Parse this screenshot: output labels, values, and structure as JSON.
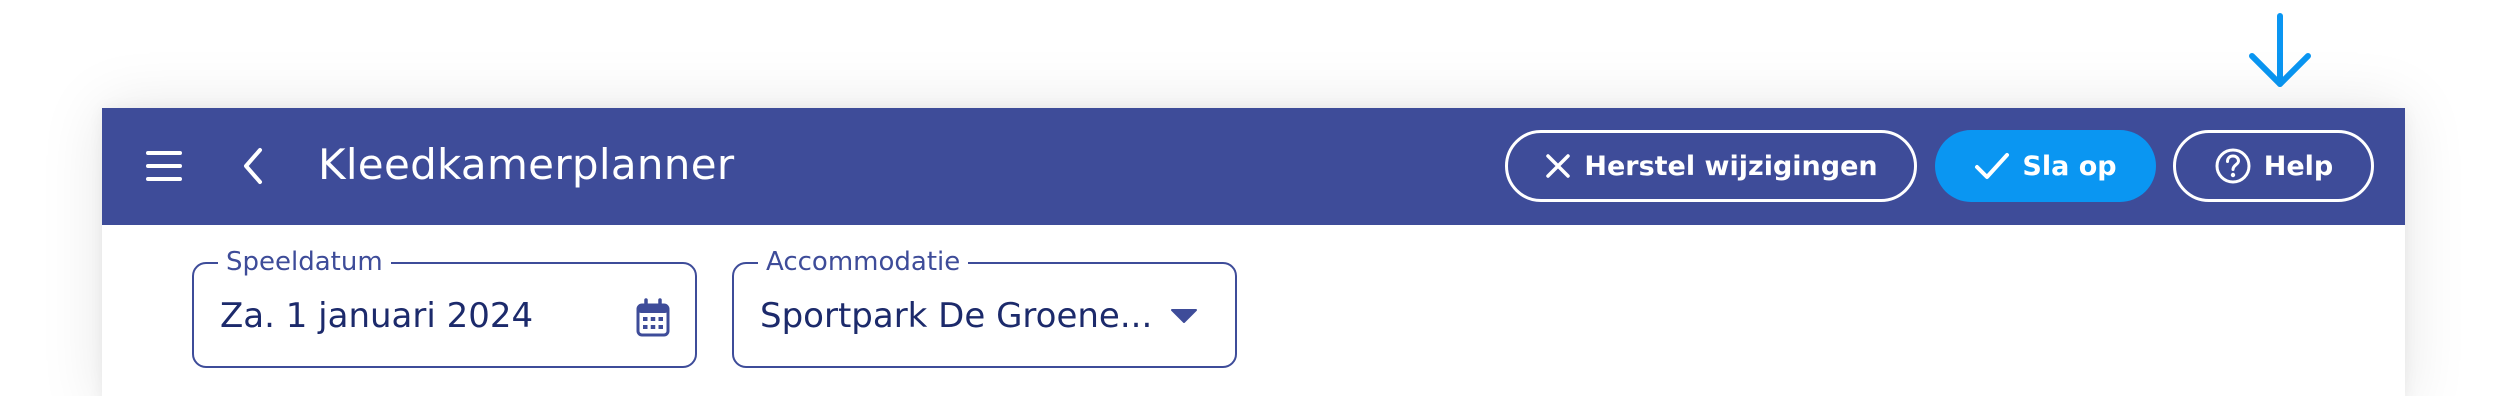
{
  "appbar": {
    "title": "Kleedkamerplanner",
    "menu_icon": "hamburger-menu-icon",
    "back_icon": "chevron-left-icon",
    "background_color": "#3e4c99"
  },
  "actions": {
    "reset_label": "Herstel wijzigingen",
    "reset_icon": "close-icon",
    "save_label": "Sla op",
    "save_icon": "checkmark-icon",
    "save_color": "#0a96f2",
    "help_label": "Help",
    "help_icon": "question-circle-icon"
  },
  "indicator": {
    "icon": "arrow-down-icon",
    "color": "#0a96f2"
  },
  "fields": {
    "date": {
      "label": "Speeldatum",
      "value": "Za. 1 januari 2024",
      "icon": "calendar-icon"
    },
    "accommodation": {
      "label": "Accommodatie",
      "value": "Sportpark De Groene...",
      "icon": "dropdown-arrow-icon"
    }
  }
}
